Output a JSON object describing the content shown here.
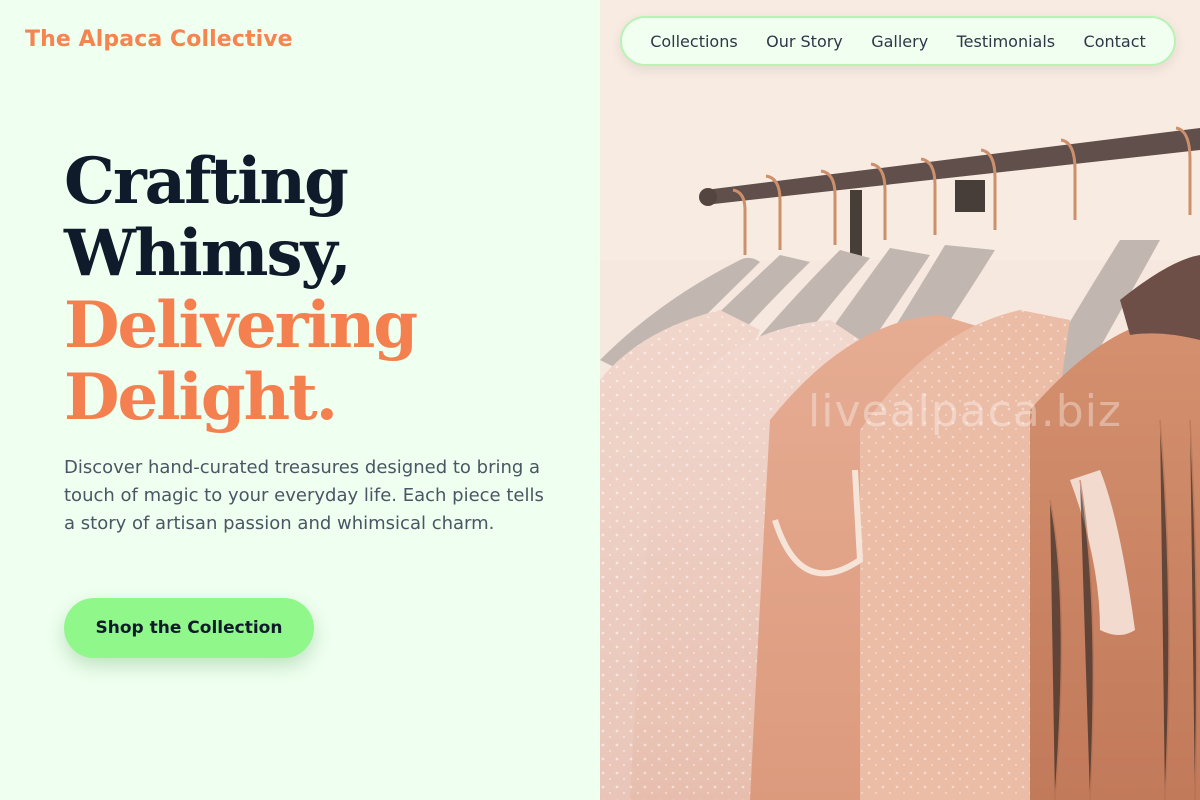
{
  "brand": {
    "name": "The Alpaca Collective"
  },
  "nav": {
    "items": [
      {
        "label": "Collections"
      },
      {
        "label": "Our Story"
      },
      {
        "label": "Gallery"
      },
      {
        "label": "Testimonials"
      },
      {
        "label": "Contact"
      }
    ]
  },
  "hero": {
    "headline_line1": "Crafting",
    "headline_line2": "Whimsy,",
    "headline_line3": "Delivering",
    "headline_line4": "Delight.",
    "description": "Discover hand-curated treasures designed to bring a touch of magic to your everyday life. Each piece tells a story of artisan passion and whimsical charm.",
    "cta_label": "Shop the Collection"
  },
  "image": {
    "subject": "clothing rack with pink and peach dresses on hangers",
    "watermark": "livealpaca.biz"
  },
  "colors": {
    "background": "#effff0",
    "brand": "#f5844f",
    "headline_dark": "#0f1a2a",
    "accent": "#f5804f",
    "cta": "#90f88a",
    "nav_border": "#b8f2b4"
  }
}
